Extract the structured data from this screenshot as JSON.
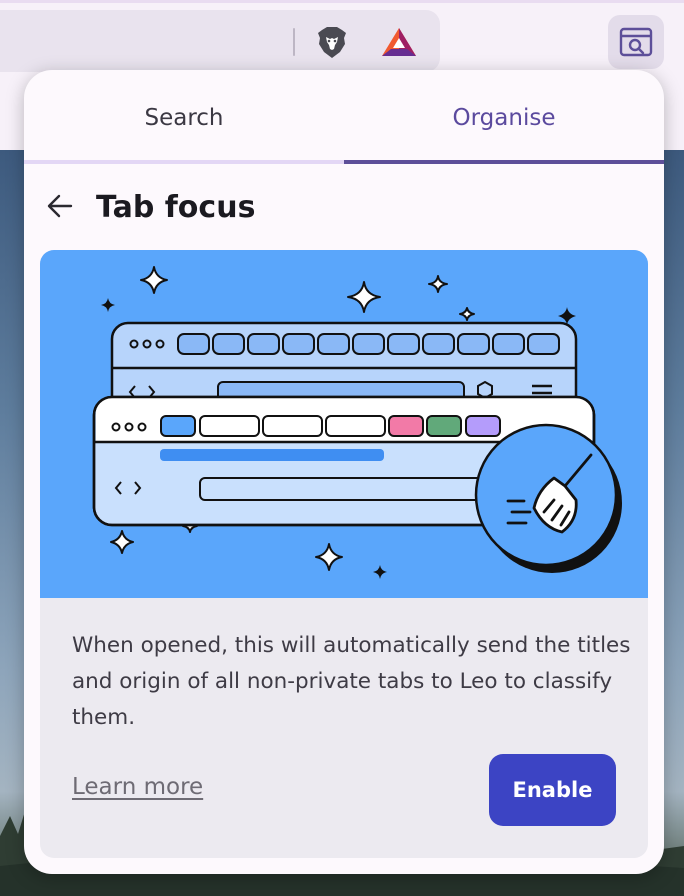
{
  "browser": {
    "toolbar_icons": [
      "brave-shields-icon",
      "bat-rewards-icon",
      "tab-focus-icon"
    ],
    "colors": {
      "toolbar": "#f7f1f9",
      "urlbar": "#e9e3ee"
    }
  },
  "popup": {
    "tabs": [
      {
        "label": "Search",
        "active": false
      },
      {
        "label": "Organise",
        "active": true
      }
    ],
    "header": {
      "back_icon": "arrow-left-icon",
      "title": "Tab focus"
    },
    "card": {
      "illustration": "browser-windows-with-broom",
      "description": "When opened, this will automatically send the titles and origin of all non-private tabs to Leo to classify them.",
      "learn_more": "Learn more",
      "enable": "Enable"
    },
    "colors": {
      "accent": "#5d4f99",
      "button": "#3c44c4",
      "illustration_bg": "#5aa6fb"
    }
  }
}
